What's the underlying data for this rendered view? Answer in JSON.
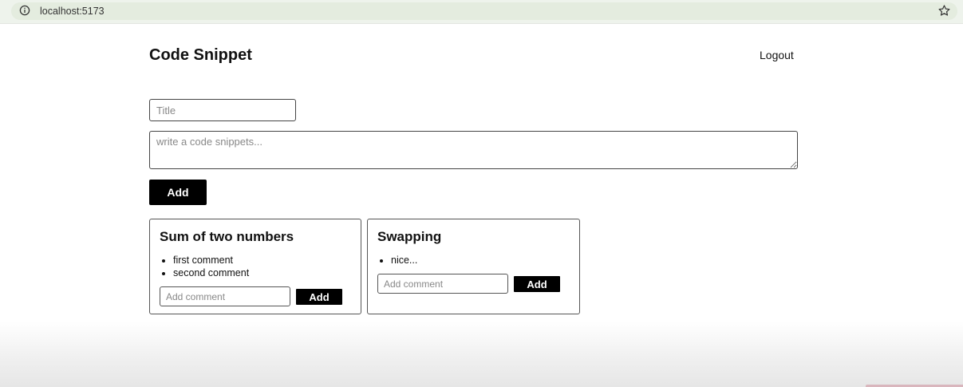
{
  "browser": {
    "url": "localhost:5173",
    "info_icon": "info-icon",
    "bookmark_icon": "star-icon"
  },
  "header": {
    "title": "Code Snippet",
    "logout_label": "Logout"
  },
  "form": {
    "title_placeholder": "Title",
    "title_value": "",
    "snippet_placeholder": "write a code snippets...",
    "snippet_value": "",
    "add_label": "Add"
  },
  "snippets": [
    {
      "title": "Sum of two numbers",
      "comments": [
        "first comment",
        "second comment"
      ],
      "comment_placeholder": "Add comment",
      "add_label": "Add"
    },
    {
      "title": "Swapping",
      "comments": [
        "nice..."
      ],
      "comment_placeholder": "Add comment",
      "add_label": "Add"
    }
  ],
  "colors": {
    "primary_button": "#000000",
    "browser_bar": "#eef3ec"
  }
}
